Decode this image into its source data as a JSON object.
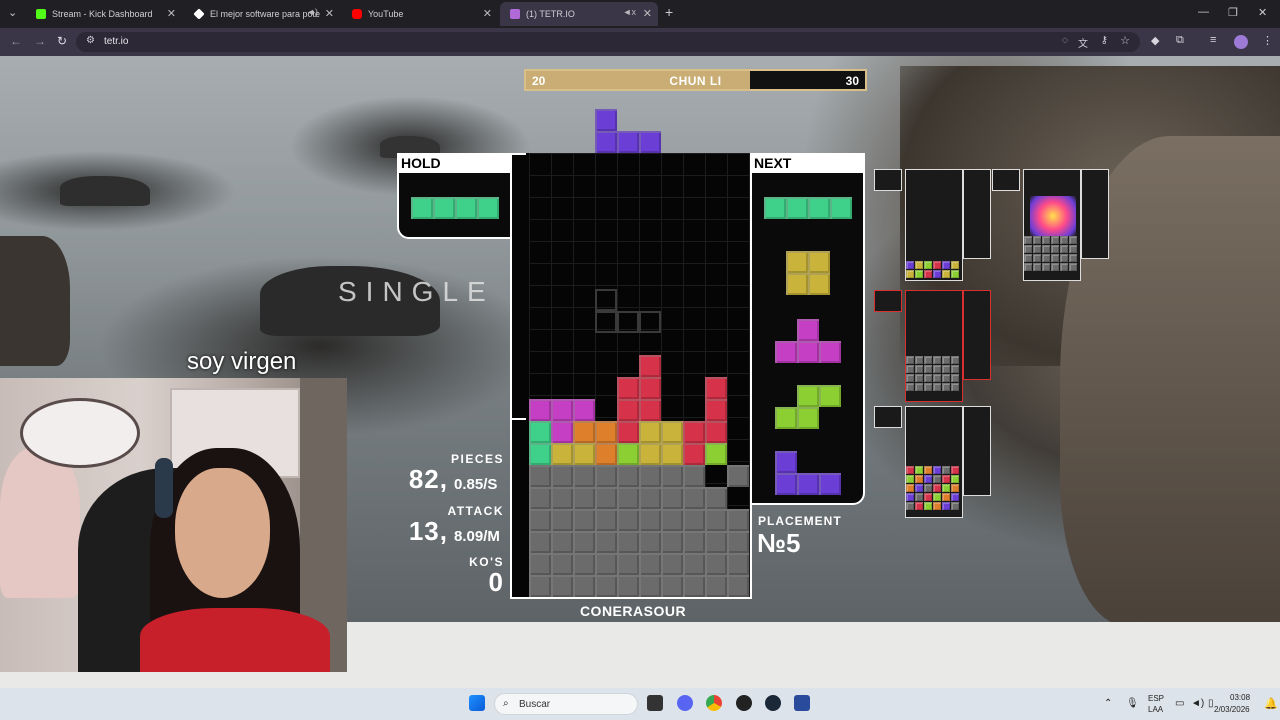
{
  "browser": {
    "tabs": [
      {
        "label": "Stream - Kick Dashboard",
        "icon": "kick-icon",
        "color": "#53fc18"
      },
      {
        "label": "El mejor software para pote",
        "icon": "diamond-icon",
        "color": "#ffffff"
      },
      {
        "label": "YouTube",
        "icon": "youtube-icon",
        "color": "#ff0000"
      },
      {
        "label": "(1) TETR.IO",
        "icon": "tetrio-icon",
        "color": "#b06ad8"
      }
    ],
    "url": "tetr.io"
  },
  "game": {
    "opponent": {
      "name": "CHUN LI",
      "left_value": "20",
      "right_value": "30",
      "progress": 0.66
    },
    "hold_label": "HOLD",
    "next_label": "NEXT",
    "clear_text": "SINGLE",
    "stats": {
      "pieces_label": "PIECES",
      "pieces": "82,",
      "pieces_rate": "0.85/S",
      "attack_label": "ATTACK",
      "attack": "13,",
      "attack_rate": "8.09/M",
      "kos_label": "KO'S",
      "kos": "0"
    },
    "placement_label": "PLACEMENT",
    "placement": "№5",
    "player_name": "CONERASOUR"
  },
  "stream": {
    "caption": "soy virgen"
  },
  "taskbar": {
    "search_placeholder": "Buscar",
    "lang_top": "ESP",
    "lang_bottom": "LAA",
    "time": "03:08",
    "date": "2/03/2026"
  },
  "colors": {
    "green": "#3fd18a",
    "yellow": "#c9b33a",
    "magenta": "#c43fc4",
    "purple": "#6b3ed6",
    "red": "#d6334a",
    "orange": "#de7f2c",
    "lime": "#8bcf32",
    "garbage": "#6b6b6b"
  }
}
